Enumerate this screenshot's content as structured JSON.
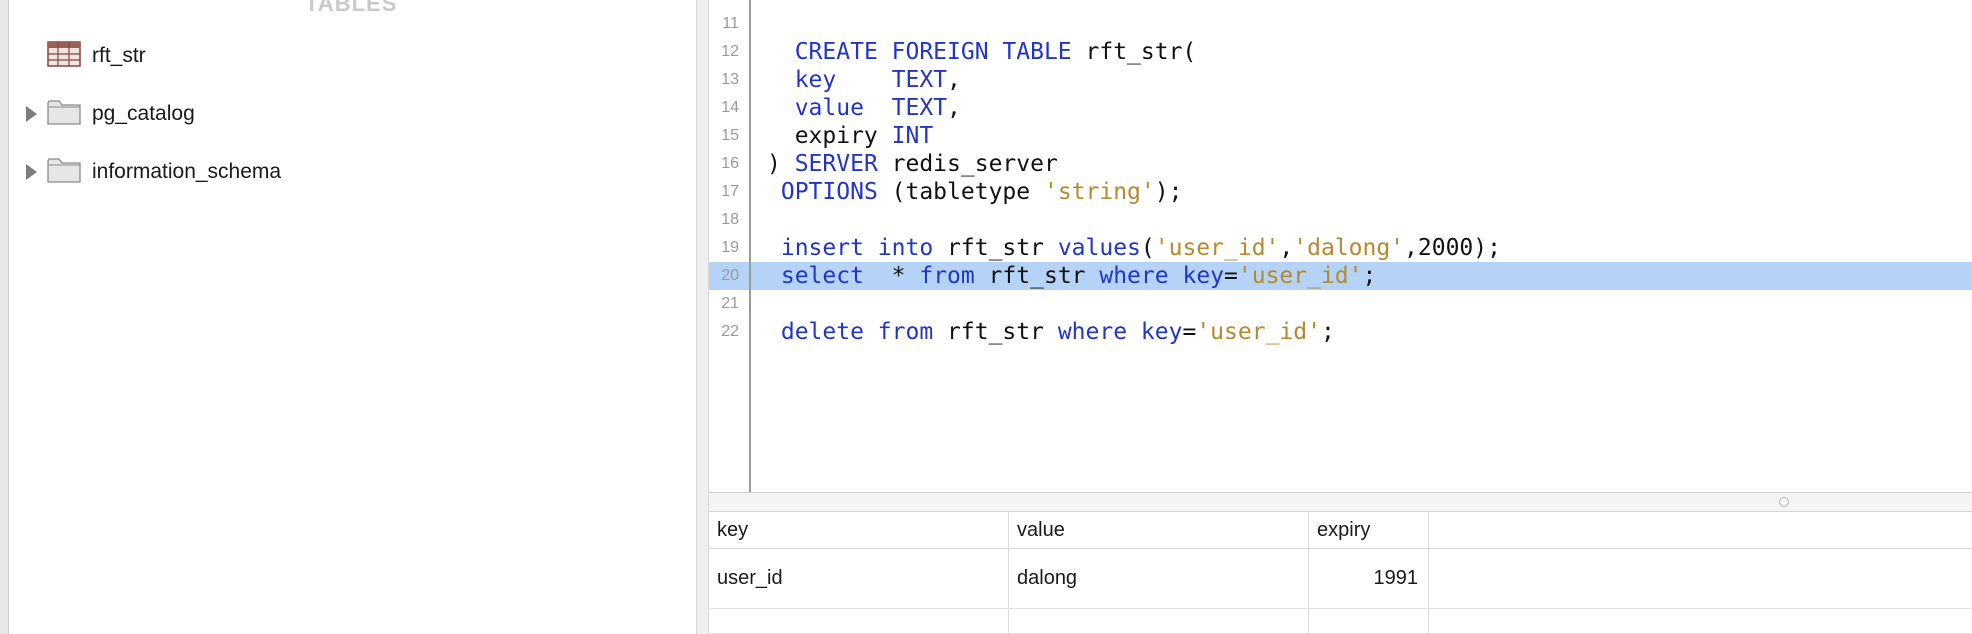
{
  "sidebar": {
    "section_title": "TABLES",
    "items": [
      {
        "label": "rft_str",
        "icon": "table-icon",
        "expandable": false
      },
      {
        "label": "pg_catalog",
        "icon": "folder-icon",
        "expandable": true
      },
      {
        "label": "information_schema",
        "icon": "folder-icon",
        "expandable": true
      }
    ]
  },
  "editor": {
    "highlighted_line": "20",
    "lines": [
      {
        "num": "11",
        "tokens": []
      },
      {
        "num": "12",
        "tokens": [
          {
            "t": "  ",
            "c": ""
          },
          {
            "t": "CREATE FOREIGN TABLE",
            "c": "kw"
          },
          {
            "t": " rft_str(",
            "c": ""
          }
        ]
      },
      {
        "num": "13",
        "tokens": [
          {
            "t": "  ",
            "c": ""
          },
          {
            "t": "key",
            "c": "kw"
          },
          {
            "t": "    ",
            "c": ""
          },
          {
            "t": "TEXT",
            "c": "kw"
          },
          {
            "t": ",",
            "c": ""
          }
        ]
      },
      {
        "num": "14",
        "tokens": [
          {
            "t": "  ",
            "c": ""
          },
          {
            "t": "value",
            "c": "kw"
          },
          {
            "t": "  ",
            "c": ""
          },
          {
            "t": "TEXT",
            "c": "kw"
          },
          {
            "t": ",",
            "c": ""
          }
        ]
      },
      {
        "num": "15",
        "tokens": [
          {
            "t": "  expiry ",
            "c": ""
          },
          {
            "t": "INT",
            "c": "kw"
          }
        ]
      },
      {
        "num": "16",
        "tokens": [
          {
            "t": ") ",
            "c": ""
          },
          {
            "t": "SERVER",
            "c": "kw"
          },
          {
            "t": " redis_server",
            "c": ""
          }
        ]
      },
      {
        "num": "17",
        "tokens": [
          {
            "t": " ",
            "c": ""
          },
          {
            "t": "OPTIONS",
            "c": "kw"
          },
          {
            "t": " (tabletype ",
            "c": ""
          },
          {
            "t": "'string'",
            "c": "str"
          },
          {
            "t": ");",
            "c": ""
          }
        ]
      },
      {
        "num": "18",
        "tokens": []
      },
      {
        "num": "19",
        "tokens": [
          {
            "t": " ",
            "c": ""
          },
          {
            "t": "insert into",
            "c": "kw"
          },
          {
            "t": " rft_str ",
            "c": ""
          },
          {
            "t": "values",
            "c": "kw"
          },
          {
            "t": "(",
            "c": ""
          },
          {
            "t": "'user_id'",
            "c": "str"
          },
          {
            "t": ",",
            "c": ""
          },
          {
            "t": "'dalong'",
            "c": "str"
          },
          {
            "t": ",2000);",
            "c": ""
          }
        ]
      },
      {
        "num": "20",
        "tokens": [
          {
            "t": " ",
            "c": ""
          },
          {
            "t": "select",
            "c": "kw"
          },
          {
            "t": "  * ",
            "c": ""
          },
          {
            "t": "from",
            "c": "kw"
          },
          {
            "t": " rft_str ",
            "c": ""
          },
          {
            "t": "where",
            "c": "kw"
          },
          {
            "t": " ",
            "c": ""
          },
          {
            "t": "key",
            "c": "kw"
          },
          {
            "t": "=",
            "c": ""
          },
          {
            "t": "'user_id'",
            "c": "str"
          },
          {
            "t": ";",
            "c": ""
          }
        ]
      },
      {
        "num": "21",
        "tokens": []
      },
      {
        "num": "22",
        "tokens": [
          {
            "t": " ",
            "c": ""
          },
          {
            "t": "delete from",
            "c": "kw"
          },
          {
            "t": " rft_str ",
            "c": ""
          },
          {
            "t": "where",
            "c": "kw"
          },
          {
            "t": " ",
            "c": ""
          },
          {
            "t": "key",
            "c": "kw"
          },
          {
            "t": "=",
            "c": ""
          },
          {
            "t": "'user_id'",
            "c": "str"
          },
          {
            "t": ";",
            "c": ""
          }
        ]
      }
    ]
  },
  "results": {
    "columns": [
      "key",
      "value",
      "expiry"
    ],
    "rows": [
      [
        "user_id",
        "dalong",
        "1991"
      ]
    ]
  },
  "colors": {
    "keyword": "#2235c4",
    "string": "#b5892d",
    "highlight": "#b5d3f7"
  }
}
